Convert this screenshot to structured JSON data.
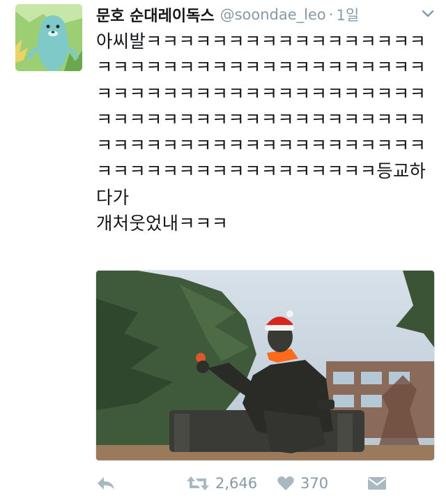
{
  "tweet": {
    "display_name": "문호 순대레이독스",
    "handle": "@soondae_leo",
    "separator": "·",
    "time": "1일",
    "text": "아씨발ㅋㅋㅋㅋㅋㅋㅋㅋㅋㅋㅋㅋㅋㅋㅋㅋㅋㅋㅋㅋㅋㅋㅋㅋㅋㅋㅋㅋㅋㅋㅋㅋㅋㅋㅋㅋㅋㅋㅋㅋㅋㅋㅋㅋㅋㅋㅋㅋㅋㅋㅋㅋㅋㅋㅋㅋㅋㅋㅋㅋㅋㅋㅋㅋㅋㅋㅋㅋㅋㅋㅋㅋㅋㅋㅋㅋㅋㅋㅋㅋㅋㅋㅋㅋㅋㅋㅋㅋㅋㅋㅋㅋㅋㅋㅋㅋㅋㅋㅋㅋㅋㅋㅋㅋㅋㅋㅋㅋㅋㅋㅋㅋㅋㅋ등교하다가\n개처웃었내ㅋㅋㅋ"
  },
  "media": {
    "alt": "Statue of a seated man wearing a Santa hat and orange scarf"
  },
  "actions": {
    "reply_icon": "reply-icon",
    "retweet_icon": "retweet-icon",
    "retweet_count": "2,646",
    "like_icon": "heart-icon",
    "like_count": "370",
    "dm_icon": "envelope-icon"
  },
  "colors": {
    "text": "#14171a",
    "muted": "#8899a6",
    "icon": "#aab8c2"
  }
}
